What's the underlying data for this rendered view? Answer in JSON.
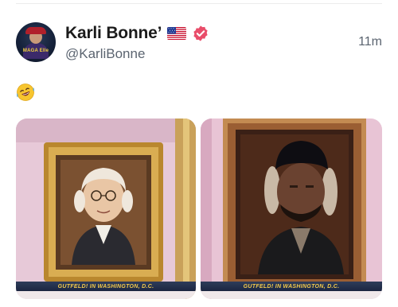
{
  "post": {
    "author": {
      "display_name": "Karli Bonne’",
      "handle": "@KarliBonne",
      "flag_icon": "us-flag-icon",
      "verified_icon": "verified-badge-icon",
      "verified_color": "#e94d6a",
      "avatar_text": "MAGA Elle"
    },
    "timestamp": "11m",
    "body_emoji": "🤣",
    "media": [
      {
        "caption": "GUTFELD! IN WASHINGTON, D.C.",
        "description_icon": "portrait-painting"
      },
      {
        "caption": "GUTFELD! IN WASHINGTON, D.C.",
        "description_icon": "portrait-painting"
      }
    ]
  }
}
